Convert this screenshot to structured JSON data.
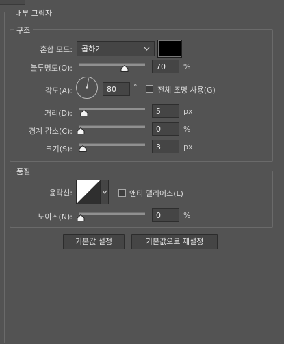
{
  "panel": {
    "title": "내부 그림자",
    "structure": {
      "title": "구조",
      "blend_mode": {
        "label": "혼합 모드:",
        "value": "곱하기",
        "color": "#000000"
      },
      "opacity": {
        "label": "불투명도(O):",
        "value": "70",
        "unit": "%",
        "level": 0.7
      },
      "angle": {
        "label": "각도(A):",
        "value": "80",
        "unit": "°",
        "global_light_label": "전체 조명 사용(G)",
        "global_light_checked": false
      },
      "distance": {
        "label": "거리(D):",
        "value": "5",
        "unit": "px",
        "level": 0.05
      },
      "choke": {
        "label": "경계 감소(C):",
        "value": "0",
        "unit": "%",
        "level": 0.0
      },
      "size": {
        "label": "크기(S):",
        "value": "3",
        "unit": "px",
        "level": 0.03
      }
    },
    "quality": {
      "title": "품질",
      "contour": {
        "label": "윤곽선:",
        "icon": "linear-contour-icon"
      },
      "anti_alias": {
        "label": "앤티 앨리어스(L)",
        "checked": false
      },
      "noise": {
        "label": "노이즈(N):",
        "value": "0",
        "unit": "%",
        "level": 0.0
      }
    },
    "buttons": {
      "make_default": "기본값 설정",
      "reset_default": "기본값으로 재설정"
    }
  }
}
